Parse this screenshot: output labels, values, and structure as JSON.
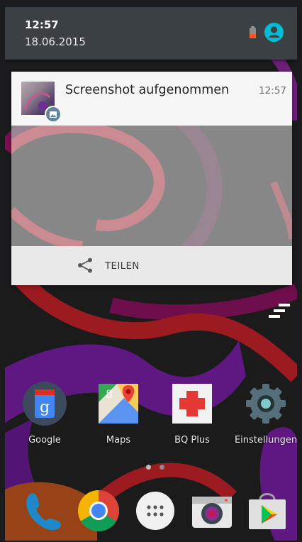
{
  "status": {
    "time": "12:57",
    "date": "18.06.2015"
  },
  "notification": {
    "title": "Screenshot aufgenommen",
    "time": "12:57",
    "action_label": "TEILEN"
  },
  "apps": [
    {
      "label": "Google",
      "icon": "google-search-icon"
    },
    {
      "label": "Maps",
      "icon": "maps-icon"
    },
    {
      "label": "BQ Plus",
      "icon": "bq-plus-icon"
    },
    {
      "label": "Einstellungen",
      "icon": "settings-gear-icon"
    }
  ],
  "dock": [
    "phone-icon",
    "chrome-icon",
    "app-drawer-icon",
    "camera-icon",
    "play-store-icon"
  ],
  "colors": {
    "header_bg": "#3b4044",
    "accent": "#00bcd4",
    "wallpaper_purple": "#7a1fa6",
    "wallpaper_magenta": "#a5126b",
    "wallpaper_red": "#c8232a"
  }
}
